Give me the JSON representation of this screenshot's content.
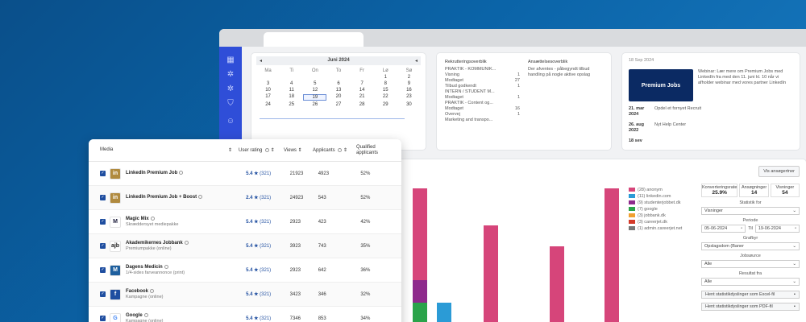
{
  "calendar": {
    "month": "Juni 2024",
    "prev": "◂",
    "next": "◂",
    "days_of_week": [
      "Ma",
      "Ti",
      "On",
      "To",
      "Fr",
      "Lø",
      "Sø"
    ],
    "weeks": [
      [
        "",
        "",
        "",
        "",
        "",
        "1",
        "2"
      ],
      [
        "3",
        "4",
        "5",
        "6",
        "7",
        "8",
        "9"
      ],
      [
        "10",
        "11",
        "12",
        "13",
        "14",
        "15",
        "16"
      ],
      [
        "17",
        "18",
        "19",
        "20",
        "21",
        "22",
        "23"
      ],
      [
        "24",
        "25",
        "26",
        "27",
        "28",
        "29",
        "30"
      ]
    ],
    "selected_day": "19"
  },
  "recruiting": {
    "title": "Rekrutteringsoverblik",
    "rows": [
      {
        "label": "PRAKTIK - KOMMUNIK...",
        "value": ""
      },
      {
        "label": "Visning",
        "value": "1"
      },
      {
        "label": "Modtaget",
        "value": "27"
      },
      {
        "label": "Tilbud godkendt",
        "value": "1"
      },
      {
        "label": "INTERN / STUDENT M...",
        "value": ""
      },
      {
        "label": "Modtaget",
        "value": "1"
      },
      {
        "label": "PRAKTIK - Content og...",
        "value": ""
      },
      {
        "label": "Modtaget",
        "value": "16"
      },
      {
        "label": "Overvej",
        "value": "1"
      },
      {
        "label": "Marketing and transpo...",
        "value": ""
      }
    ],
    "right_title": "Ansættelsesoverblik",
    "right_text": "Der afventes - påbegyndt tilbud handling på nogle aktive opslag"
  },
  "news": {
    "header": "18 Sep 2024",
    "banner": "Premium Jobs",
    "webinar_text": "Webinar: Lær mere om Premium Jobs med LinkedIn fra med den 11. juni kl. 10 når vi afholder webinar med vores partner LinkedIn",
    "items": [
      {
        "date": "21. mar 2024",
        "text": "Opdel et fornyet Recruit"
      },
      {
        "date": "26. aug 2022",
        "text": "Nyt Help Center"
      },
      {
        "date": "18 sev",
        "text": ""
      }
    ]
  },
  "legend": {
    "items": [
      {
        "label": "(28) anonym",
        "color": "#d6457a"
      },
      {
        "label": "(11) linkedin.com",
        "color": "#2b9bd6"
      },
      {
        "label": "(9) studenterjobbet.dk",
        "color": "#8e2a8c"
      },
      {
        "label": "(7) google",
        "color": "#2aa34a"
      },
      {
        "label": "(3) jobbank.dk",
        "color": "#f0a030"
      },
      {
        "label": "(3) careerjet.dk",
        "color": "#d43a2a"
      },
      {
        "label": "(1) admin.careerjet.net",
        "color": "#777777"
      }
    ]
  },
  "panel": {
    "button": "Vis ansøgertner",
    "kpis": [
      {
        "label": "Konverteringsrate",
        "value": "25.9%"
      },
      {
        "label": "Ansøgninger",
        "value": "14"
      },
      {
        "label": "Visninger",
        "value": "54"
      }
    ],
    "stat_label": "Statistik for",
    "stat_value": "Visninger",
    "period_label": "Periode",
    "date_from": "05-06-2024",
    "date_to_prefix": "Til",
    "date_to": "19-06-2024",
    "group_label": "Grafbyr",
    "group_value": "Opslagsdom (Baner",
    "jobsource_label": "Jobsøurce",
    "jobsource_value": "Alle",
    "result_label": "Resultat fra",
    "result_value": "Alle",
    "export1": "Hent statistikdyslinger som Excel-fil",
    "export2": "Hent statistikdyslinger som PDF-fil"
  },
  "media_table": {
    "headers": {
      "media": "Media",
      "rating": "User rating",
      "views": "Views",
      "applicants": "Applicants",
      "qualified": "Qualified applicants"
    },
    "rows": [
      {
        "name": "LinkedIn Premium Job",
        "sub": "",
        "rating": "5.4 ★",
        "count": "(321)",
        "views": "21923",
        "applicants": "4923",
        "qualified": "52%",
        "logo": "in",
        "logo_bg": "#b08a3e",
        "logo_fg": "#ffffff"
      },
      {
        "name": "LinkedIn Premium Job + Boost",
        "sub": "",
        "rating": "2.4 ★",
        "count": "(321)",
        "views": "24923",
        "applicants": "543",
        "qualified": "52%",
        "logo": "in",
        "logo_bg": "#b08a3e",
        "logo_fg": "#ffffff"
      },
      {
        "name": "Magic Mix",
        "sub": "Skræddersyet mediepakke",
        "rating": "5.4 ★",
        "count": "(321)",
        "views": "2923",
        "applicants": "423",
        "qualified": "42%",
        "logo": "M",
        "logo_bg": "#ffffff",
        "logo_fg": "#1a1a3a"
      },
      {
        "name": "Akademikernes Jobbank",
        "sub": "Premiumpakke (online)",
        "rating": "5.4 ★",
        "count": "(321)",
        "views": "3923",
        "applicants": "743",
        "qualified": "35%",
        "logo": "ajb",
        "logo_bg": "#ffffff",
        "logo_fg": "#222222"
      },
      {
        "name": "Dagens Medicin",
        "sub": "1/4-sides farveannonce (print)",
        "rating": "5.4 ★",
        "count": "(321)",
        "views": "2923",
        "applicants": "642",
        "qualified": "36%",
        "logo": "M",
        "logo_bg": "#1e5f9e",
        "logo_fg": "#ffffff"
      },
      {
        "name": "Facebook",
        "sub": "Kampagne (online)",
        "rating": "5.4 ★",
        "count": "(321)",
        "views": "3423",
        "applicants": "346",
        "qualified": "32%",
        "logo": "f",
        "logo_bg": "#1f4ea0",
        "logo_fg": "#ffffff"
      },
      {
        "name": "Google",
        "sub": "Kampagne (online)",
        "rating": "5.4 ★",
        "count": "(321)",
        "views": "7346",
        "applicants": "853",
        "qualified": "34%",
        "logo": "G",
        "logo_bg": "#ffffff",
        "logo_fg": "#4285f4"
      }
    ]
  }
}
